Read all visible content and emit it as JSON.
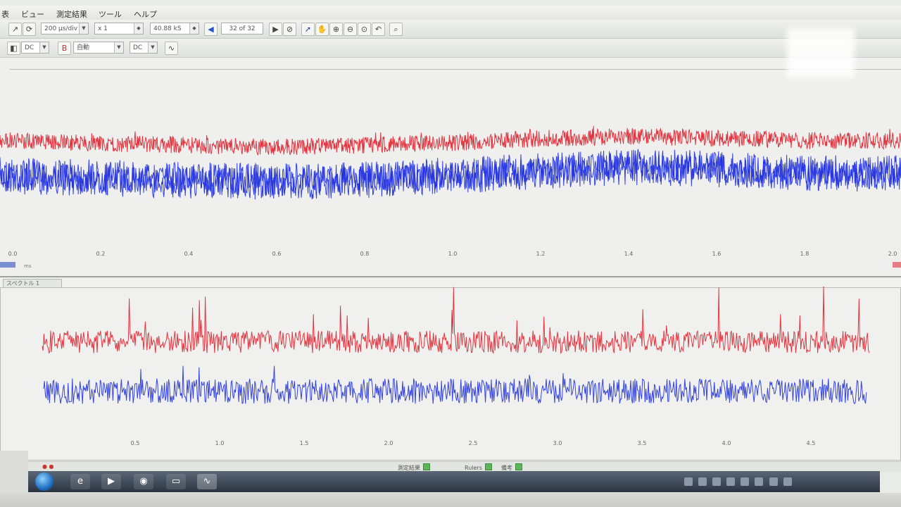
{
  "menu": [
    "表",
    "ビュー",
    "測定結果",
    "ツール",
    "ヘルプ"
  ],
  "toolbar1": {
    "timebase": "200 μs/div",
    "zoom": "x 1",
    "samples": "40.88 kS",
    "capture": "32 of 32"
  },
  "toolbar2": {
    "channel_a_coupling": "DC",
    "channel_b_range": "自動",
    "channel_b_coupling": "DC"
  },
  "scope": {
    "x_ticks": [
      "0.0",
      "0.2",
      "0.4",
      "0.6",
      "0.8",
      "1.0",
      "1.2",
      "1.4",
      "1.6",
      "1.8",
      "2.0"
    ],
    "x_unit": "ms",
    "channel_a_color": "#1f2fe0",
    "channel_b_color": "#e0202c"
  },
  "spectrum": {
    "tab_label": "スペクトル 1",
    "x_ticks": [
      "0.5",
      "1.0",
      "1.5",
      "2.0",
      "2.5",
      "3.0",
      "3.5",
      "4.0",
      "4.5"
    ],
    "channel_a_color": "#1f2fe0",
    "channel_b_color": "#e0202c"
  },
  "statusbar": {
    "left": "測定結果",
    "middle": "Rulers",
    "right": "備考"
  },
  "chart_data": [
    {
      "type": "line",
      "x": [
        0.0,
        0.2,
        0.4,
        0.6,
        0.8,
        1.0,
        1.2,
        1.4,
        1.6,
        1.8,
        2.0
      ],
      "xlabel": "ms",
      "series": [
        {
          "values": [
            0.62,
            0.61,
            0.6,
            0.59,
            0.6,
            0.61,
            0.63,
            0.64,
            0.63,
            0.62,
            0.62
          ]
        },
        {
          "values": [
            0.46,
            0.45,
            0.44,
            0.43,
            0.44,
            0.46,
            0.48,
            0.5,
            0.49,
            0.47,
            0.47
          ]
        }
      ],
      "grid": false
    },
    {
      "type": "line",
      "x": [
        0.5,
        1.0,
        1.5,
        2.0,
        2.5,
        3.0,
        3.5,
        4.0,
        4.5
      ],
      "series": [
        {
          "values": [
            0.55,
            0.55,
            0.55,
            0.55,
            0.55,
            0.55,
            0.55,
            0.55,
            0.55
          ]
        },
        {
          "values": [
            0.35,
            0.35,
            0.35,
            0.35,
            0.35,
            0.35,
            0.35,
            0.35,
            0.35
          ]
        }
      ],
      "grid": false
    }
  ]
}
